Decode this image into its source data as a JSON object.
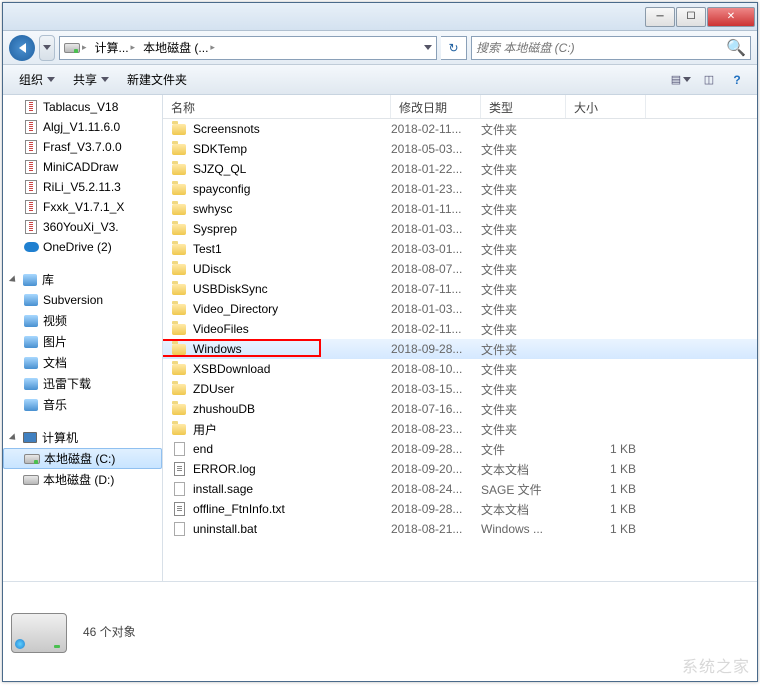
{
  "titlebar": {
    "min": "─",
    "max": "☐",
    "close": "✕"
  },
  "nav": {
    "crumbs": [
      "计算...",
      "本地磁盘 (..."
    ],
    "search_placeholder": "搜索 本地磁盘 (C:)"
  },
  "toolbar": {
    "organize": "组织",
    "share": "共享",
    "newfolder": "新建文件夹"
  },
  "sidebar": {
    "favorites": [
      {
        "label": "Tablacus_V18",
        "icon": "archive"
      },
      {
        "label": "Algj_V1.11.6.0",
        "icon": "archive"
      },
      {
        "label": "Frasf_V3.7.0.0",
        "icon": "archive"
      },
      {
        "label": "MiniCADDraw",
        "icon": "archive"
      },
      {
        "label": "RiLi_V5.2.11.3",
        "icon": "archive"
      },
      {
        "label": "Fxxk_V1.7.1_X",
        "icon": "archive"
      },
      {
        "label": "360YouXi_V3.",
        "icon": "archive"
      },
      {
        "label": "OneDrive (2)",
        "icon": "onedrive"
      }
    ],
    "library_label": "库",
    "libraries": [
      {
        "label": "Subversion",
        "icon": "lib"
      },
      {
        "label": "视频",
        "icon": "lib"
      },
      {
        "label": "图片",
        "icon": "lib"
      },
      {
        "label": "文档",
        "icon": "lib"
      },
      {
        "label": "迅雷下载",
        "icon": "lib"
      },
      {
        "label": "音乐",
        "icon": "lib"
      }
    ],
    "computer_label": "计算机",
    "drives": [
      {
        "label": "本地磁盘 (C:)",
        "icon": "drive-c",
        "selected": true
      },
      {
        "label": "本地磁盘 (D:)",
        "icon": "drive"
      }
    ]
  },
  "columns": {
    "name": "名称",
    "date": "修改日期",
    "type": "类型",
    "size": "大小"
  },
  "files": [
    {
      "name": "Screensnots",
      "date": "2018-02-11...",
      "type": "文件夹",
      "size": "",
      "icon": "folder"
    },
    {
      "name": "SDKTemp",
      "date": "2018-05-03...",
      "type": "文件夹",
      "size": "",
      "icon": "folder"
    },
    {
      "name": "SJZQ_QL",
      "date": "2018-01-22...",
      "type": "文件夹",
      "size": "",
      "icon": "folder"
    },
    {
      "name": "spayconfig",
      "date": "2018-01-23...",
      "type": "文件夹",
      "size": "",
      "icon": "folder"
    },
    {
      "name": "swhysc",
      "date": "2018-01-11...",
      "type": "文件夹",
      "size": "",
      "icon": "folder"
    },
    {
      "name": "Sysprep",
      "date": "2018-01-03...",
      "type": "文件夹",
      "size": "",
      "icon": "folder"
    },
    {
      "name": "Test1",
      "date": "2018-03-01...",
      "type": "文件夹",
      "size": "",
      "icon": "folder"
    },
    {
      "name": "UDisck",
      "date": "2018-08-07...",
      "type": "文件夹",
      "size": "",
      "icon": "folder"
    },
    {
      "name": "USBDiskSync",
      "date": "2018-07-11...",
      "type": "文件夹",
      "size": "",
      "icon": "folder"
    },
    {
      "name": "Video_Directory",
      "date": "2018-01-03...",
      "type": "文件夹",
      "size": "",
      "icon": "folder"
    },
    {
      "name": "VideoFiles",
      "date": "2018-02-11...",
      "type": "文件夹",
      "size": "",
      "icon": "folder"
    },
    {
      "name": "Windows",
      "date": "2018-09-28...",
      "type": "文件夹",
      "size": "",
      "icon": "folder",
      "highlighted": true,
      "redbox": true
    },
    {
      "name": "XSBDownload",
      "date": "2018-08-10...",
      "type": "文件夹",
      "size": "",
      "icon": "folder"
    },
    {
      "name": "ZDUser",
      "date": "2018-03-15...",
      "type": "文件夹",
      "size": "",
      "icon": "folder"
    },
    {
      "name": "zhushouDB",
      "date": "2018-07-16...",
      "type": "文件夹",
      "size": "",
      "icon": "folder"
    },
    {
      "name": "用户",
      "date": "2018-08-23...",
      "type": "文件夹",
      "size": "",
      "icon": "folder"
    },
    {
      "name": "end",
      "date": "2018-09-28...",
      "type": "文件",
      "size": "1 KB",
      "icon": "file"
    },
    {
      "name": "ERROR.log",
      "date": "2018-09-20...",
      "type": "文本文档",
      "size": "1 KB",
      "icon": "txt"
    },
    {
      "name": "install.sage",
      "date": "2018-08-24...",
      "type": "SAGE 文件",
      "size": "1 KB",
      "icon": "file"
    },
    {
      "name": "offline_FtnInfo.txt",
      "date": "2018-09-28...",
      "type": "文本文档",
      "size": "1 KB",
      "icon": "txt"
    },
    {
      "name": "uninstall.bat",
      "date": "2018-08-21...",
      "type": "Windows ...",
      "size": "1 KB",
      "icon": "file"
    }
  ],
  "status": {
    "count": "46 个对象"
  },
  "watermark": "系统之家"
}
